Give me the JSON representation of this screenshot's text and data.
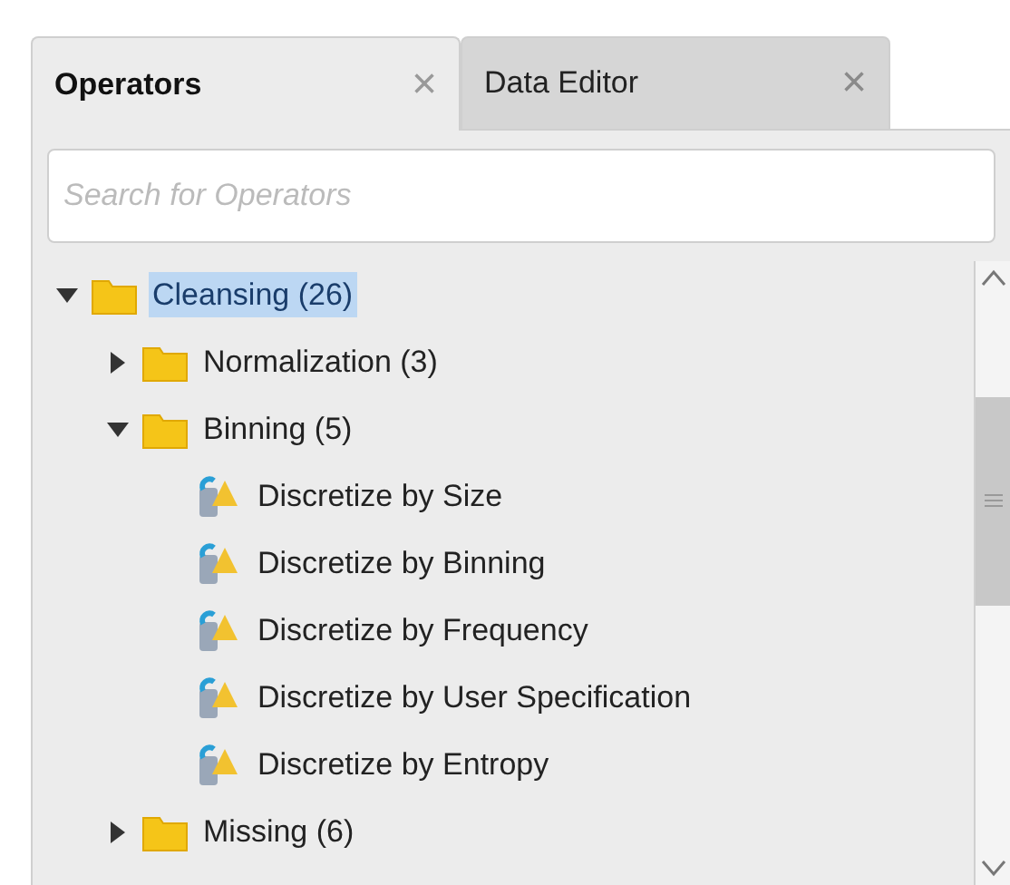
{
  "tabs": [
    {
      "label": "Operators",
      "selected": true,
      "close": "×"
    },
    {
      "label": "Data Editor",
      "selected": false,
      "close": "×"
    }
  ],
  "search": {
    "placeholder": "Search for Operators"
  },
  "tree": [
    {
      "kind": "folder",
      "label": "Cleansing (26)",
      "expanded": true,
      "selected": true,
      "children": [
        {
          "kind": "folder",
          "label": "Normalization (3)",
          "expanded": false,
          "selected": false
        },
        {
          "kind": "folder",
          "label": "Binning (5)",
          "expanded": true,
          "selected": false,
          "children": [
            {
              "kind": "operator",
              "label": "Discretize by Size",
              "selected": false
            },
            {
              "kind": "operator",
              "label": "Discretize by Binning",
              "selected": false
            },
            {
              "kind": "operator",
              "label": "Discretize by Frequency",
              "selected": false
            },
            {
              "kind": "operator",
              "label": "Discretize by User Specification",
              "selected": false
            },
            {
              "kind": "operator",
              "label": "Discretize by Entropy",
              "selected": false
            }
          ]
        },
        {
          "kind": "folder",
          "label": "Missing (6)",
          "expanded": false,
          "selected": false
        }
      ]
    }
  ]
}
